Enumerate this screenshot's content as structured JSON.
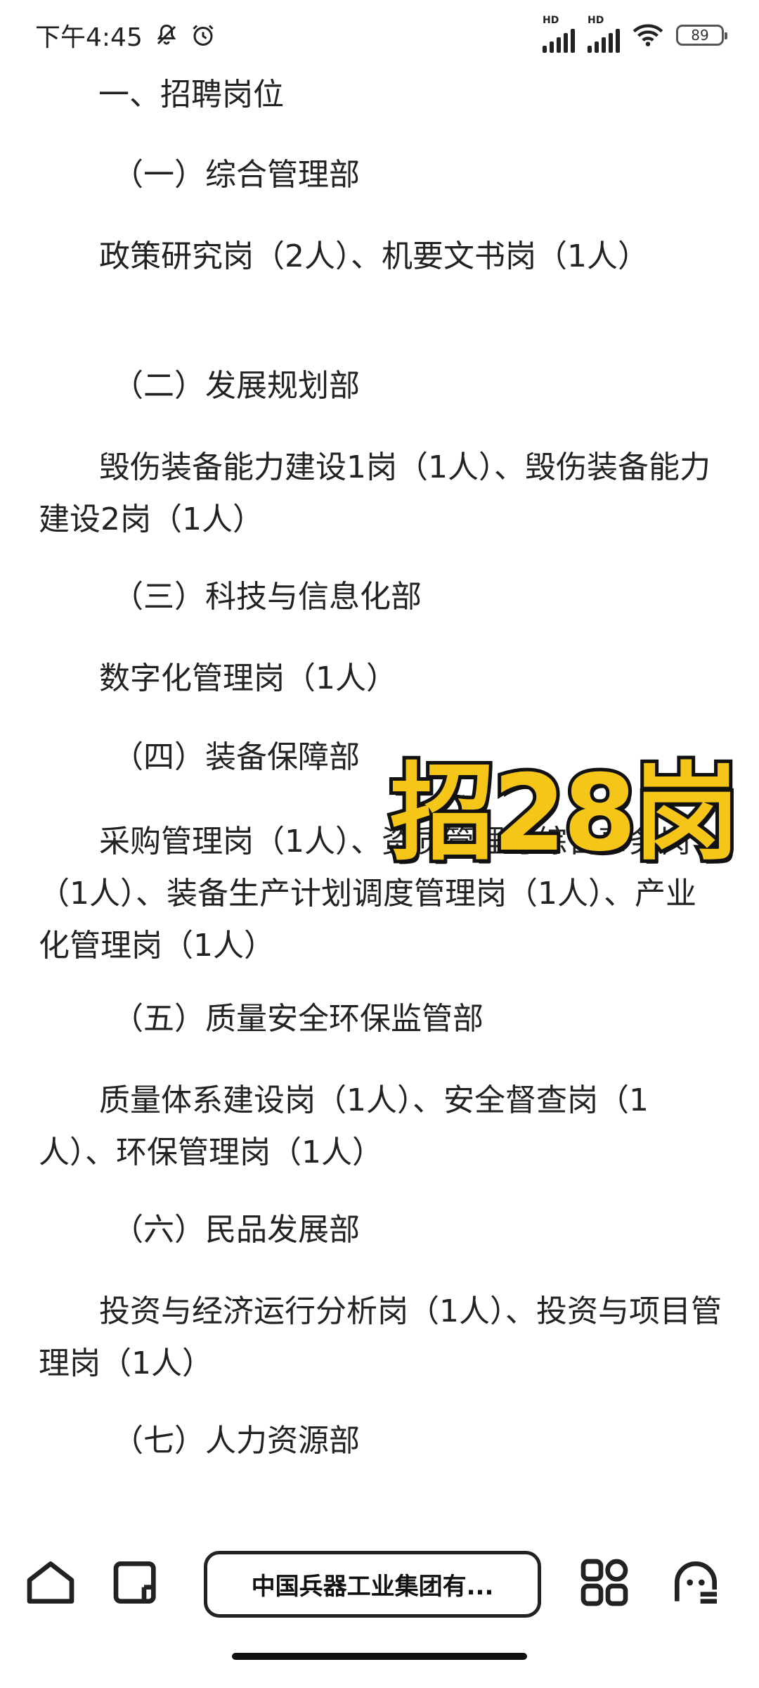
{
  "status_bar": {
    "time": "下午4:45",
    "battery": "89",
    "hd_label": "HD"
  },
  "article": {
    "heading_main": "一、招聘岗位",
    "s1_title": "（一）综合管理部",
    "s1_body": "政策研究岗（2人）、机要文书岗（1人）",
    "s2_title": "（二）发展规划部",
    "s2_body": "毁伤装备能力建设1岗（1人）、毁伤装备能力建设2岗（1人）",
    "s3_title": "（三）科技与信息化部",
    "s3_body": "数字化管理岗（1人）",
    "s4_title": "（四）装备保障部",
    "s4_body": "采购管理岗（1人）、资质管理与综合事务岗（1人）、装备生产计划调度管理岗（1人）、产业化管理岗（1人）",
    "s5_title": "（五）质量安全环保监管部",
    "s5_body": "质量体系建设岗（1人）、安全督查岗（1人）、环保管理岗（1人）",
    "s6_title": "（六）民品发展部",
    "s6_body": "投资与经济运行分析岗（1人）、投资与项目管理岗（1人）",
    "s7_title": "（七）人力资源部",
    "s7_body_partial": "……"
  },
  "overlay_text": "招28岗",
  "toolbar": {
    "search_text": "中国兵器工业集团有..."
  },
  "colors": {
    "overlay_fill": "#f5c518",
    "overlay_stroke": "#111111",
    "text": "#222222"
  }
}
